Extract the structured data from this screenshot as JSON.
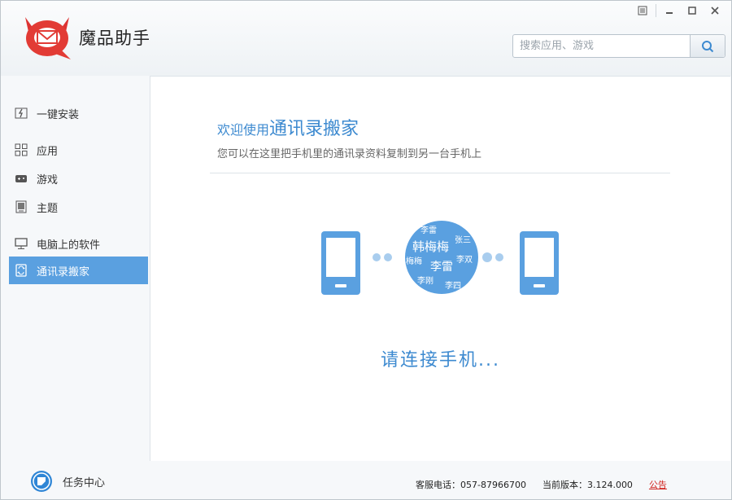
{
  "app": {
    "title": "魔品助手"
  },
  "window_controls": {
    "menu": "menu-icon",
    "minimize": "minimize-icon",
    "maximize": "maximize-icon",
    "close": "close-icon"
  },
  "search": {
    "placeholder": "搜索应用、游戏"
  },
  "sidebar": {
    "items": [
      {
        "label": "一键安装",
        "icon": "install-icon"
      },
      {
        "label": "应用",
        "icon": "apps-grid-icon"
      },
      {
        "label": "游戏",
        "icon": "gamepad-icon"
      },
      {
        "label": "主题",
        "icon": "theme-icon"
      },
      {
        "label": "电脑上的软件",
        "icon": "monitor-icon"
      },
      {
        "label": "通讯录搬家",
        "icon": "contacts-transfer-icon",
        "active": true
      }
    ]
  },
  "main": {
    "welcome_prefix": "欢迎使用",
    "welcome_title": "通讯录搬家",
    "subtitle": "您可以在这里把手机里的通讯录资料复制到另一台手机上",
    "bubble_names": [
      "李雷",
      "张三",
      "韩梅梅",
      "梅梅",
      "李雷",
      "李刚",
      "李四",
      "李双"
    ],
    "status": "请连接手机..."
  },
  "footer": {
    "task_center": "任务中心",
    "service_phone": "客服电话：057-87966700",
    "version": "当前版本：3.124.000",
    "notice": "公告"
  },
  "colors": {
    "accent": "#5aa0e0",
    "title_blue": "#3d8ad0",
    "notice_red": "#d0211c"
  }
}
